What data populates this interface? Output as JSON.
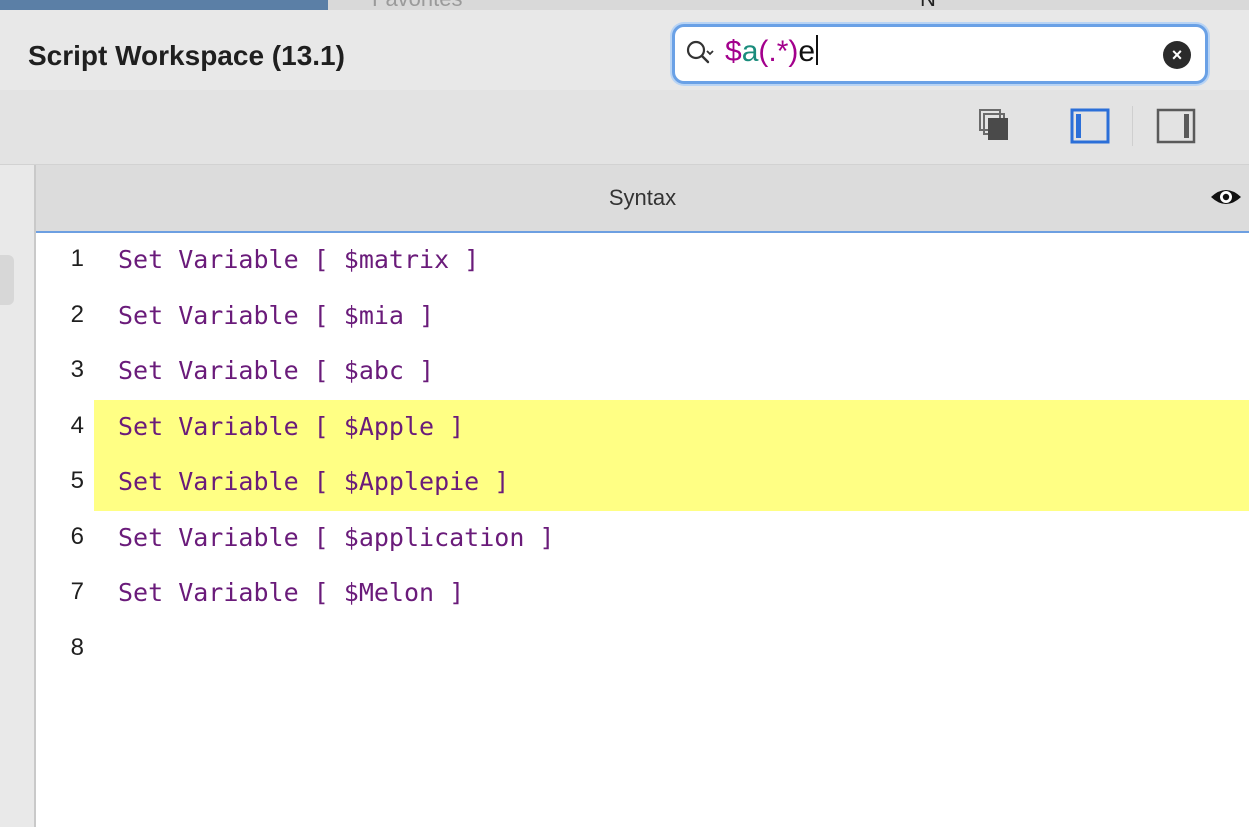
{
  "window_title": "Script Workspace (13.1)",
  "behind_tabs": [
    "Favorites",
    "N"
  ],
  "search": {
    "parts": [
      "$",
      "a",
      "(",
      ".*",
      ")",
      "e"
    ],
    "clear_icon": "clear-icon",
    "search_icon": "magnifier-icon"
  },
  "toolbar": {
    "icons": [
      "copy-layers-icon",
      "left-panel-icon",
      "right-panel-icon"
    ]
  },
  "header": {
    "column_label": "Syntax",
    "eye_icon": "eye-icon"
  },
  "lines": [
    {
      "number": "1",
      "code": "Set Variable [ $matrix ]",
      "highlighted": false
    },
    {
      "number": "2",
      "code": "Set Variable [ $mia ]",
      "highlighted": false
    },
    {
      "number": "3",
      "code": "Set Variable [ $abc ]",
      "highlighted": false
    },
    {
      "number": "4",
      "code": "Set Variable [ $Apple ]",
      "highlighted": true
    },
    {
      "number": "5",
      "code": "Set Variable [ $Applepie ]",
      "highlighted": true
    },
    {
      "number": "6",
      "code": "Set Variable [ $application ]",
      "highlighted": false
    },
    {
      "number": "7",
      "code": "Set Variable [ $Melon ]",
      "highlighted": false
    },
    {
      "number": "8",
      "code": "",
      "highlighted": false
    }
  ],
  "colors": {
    "highlight": "#ffff84",
    "code_text": "#6a1b7a",
    "accent": "#6aa1e6"
  }
}
